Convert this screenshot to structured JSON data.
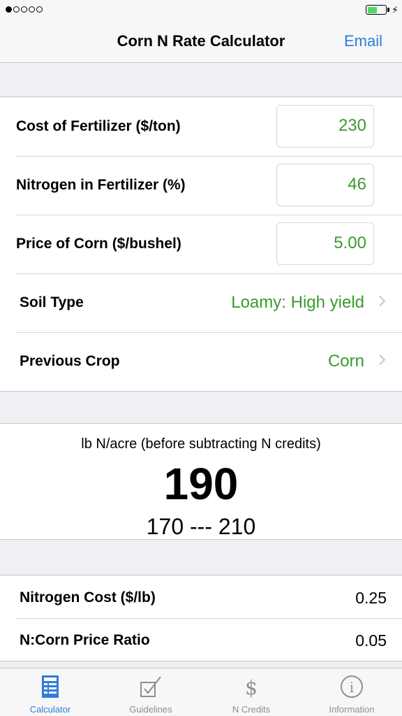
{
  "status": {
    "signal_dots_filled": 1,
    "signal_dots_total": 5,
    "battery_level": 0.55
  },
  "nav": {
    "title": "Corn N Rate Calculator",
    "right_button": "Email"
  },
  "inputs": [
    {
      "label": "Cost of Fertilizer ($/ton)",
      "value": "230"
    },
    {
      "label": "Nitrogen in Fertilizer (%)",
      "value": "46"
    },
    {
      "label": "Price of Corn ($/bushel)",
      "value": "5.00"
    }
  ],
  "selectors": [
    {
      "label": "Soil Type",
      "value": "Loamy: High yield"
    },
    {
      "label": "Previous Crop",
      "value": "Corn"
    }
  ],
  "result": {
    "caption": "lb N/acre (before subtracting N credits)",
    "value": "190",
    "range": "170 --- 210"
  },
  "details": [
    {
      "label": "Nitrogen Cost ($/lb)",
      "value": "0.25"
    },
    {
      "label": "N:Corn Price Ratio",
      "value": "0.05"
    }
  ],
  "tabs": [
    {
      "label": "Calculator",
      "icon": "calculator-icon",
      "active": true
    },
    {
      "label": "Guidelines",
      "icon": "checkbox-icon",
      "active": false
    },
    {
      "label": "N Credits",
      "icon": "dollar-icon",
      "active": false
    },
    {
      "label": "Information",
      "icon": "info-icon",
      "active": false
    }
  ],
  "colors": {
    "accent": "#2f7cd8",
    "value_green": "#3a9a2e",
    "inactive": "#8e8e93"
  }
}
